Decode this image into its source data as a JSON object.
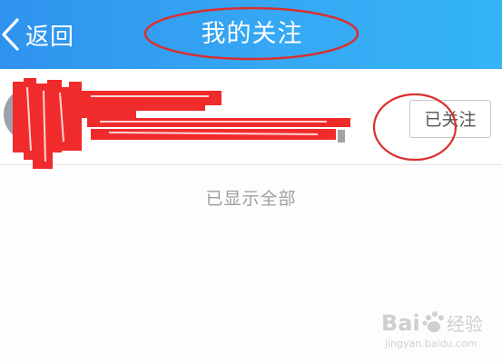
{
  "header": {
    "back_label": "返回",
    "title": "我的关注",
    "background_color": "#34a4f2"
  },
  "follow_list": {
    "items": [
      {
        "follow_button_label": "已关注"
      }
    ],
    "end_text": "已显示全部"
  },
  "annotations": {
    "circle_color": "#d9302f",
    "redaction_color": "#f02b2b"
  },
  "watermark": {
    "brand": "Bai",
    "brand_suffix": "经验",
    "url": "jingyan.baidu.com"
  }
}
